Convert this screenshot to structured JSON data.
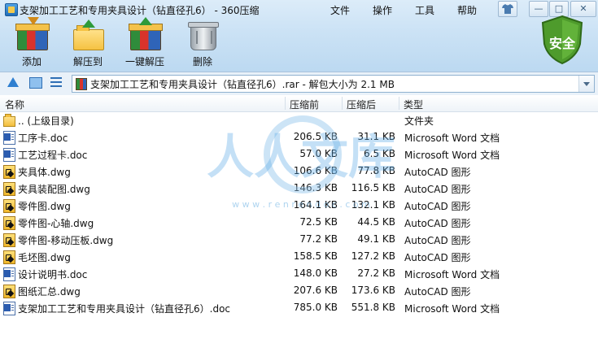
{
  "window": {
    "title": "支架加工工艺和专用夹具设计（钻直径孔6） - 360压缩"
  },
  "menu": {
    "file": "文件",
    "operate": "操作",
    "tools": "工具",
    "help": "帮助"
  },
  "window_controls": {
    "minimize": "—",
    "maximize": "□",
    "close": "✕"
  },
  "toolbar": {
    "add": "添加",
    "extract_to": "解压到",
    "one_click_extract": "一键解压",
    "delete": "删除"
  },
  "security": {
    "label": "安全"
  },
  "address": {
    "text": "支架加工工艺和专用夹具设计（钻直径孔6）.rar - 解包大小为 2.1 MB"
  },
  "columns": {
    "name": "名称",
    "compressed": "压缩前",
    "original": "压缩后",
    "type": "类型"
  },
  "files": [
    {
      "icon": "folder",
      "name": ".. (上级目录)",
      "compressed": "",
      "original": "",
      "type": "文件夹"
    },
    {
      "icon": "doc",
      "name": "工序卡.doc",
      "compressed": "206.5 KB",
      "original": "31.1 KB",
      "type": "Microsoft Word 文档"
    },
    {
      "icon": "doc",
      "name": "工艺过程卡.doc",
      "compressed": "57.0 KB",
      "original": "6.5 KB",
      "type": "Microsoft Word 文档"
    },
    {
      "icon": "dwg",
      "name": "夹具体.dwg",
      "compressed": "106.6 KB",
      "original": "77.8 KB",
      "type": "AutoCAD 图形"
    },
    {
      "icon": "dwg",
      "name": "夹具装配图.dwg",
      "compressed": "146.3 KB",
      "original": "116.5 KB",
      "type": "AutoCAD 图形"
    },
    {
      "icon": "dwg",
      "name": "零件图.dwg",
      "compressed": "164.1 KB",
      "original": "132.1 KB",
      "type": "AutoCAD 图形"
    },
    {
      "icon": "dwg",
      "name": "零件图-心轴.dwg",
      "compressed": "72.5 KB",
      "original": "44.5 KB",
      "type": "AutoCAD 图形"
    },
    {
      "icon": "dwg",
      "name": "零件图-移动压板.dwg",
      "compressed": "77.2 KB",
      "original": "49.1 KB",
      "type": "AutoCAD 图形"
    },
    {
      "icon": "dwg",
      "name": "毛坯图.dwg",
      "compressed": "158.5 KB",
      "original": "127.2 KB",
      "type": "AutoCAD 图形"
    },
    {
      "icon": "doc",
      "name": "设计说明书.doc",
      "compressed": "148.0 KB",
      "original": "27.2 KB",
      "type": "Microsoft Word 文档"
    },
    {
      "icon": "dwg",
      "name": "图纸汇总.dwg",
      "compressed": "207.6 KB",
      "original": "173.6 KB",
      "type": "AutoCAD 图形"
    },
    {
      "icon": "doc",
      "name": "支架加工工艺和专用夹具设计（钻直径孔6）.doc",
      "compressed": "785.0 KB",
      "original": "551.8 KB",
      "type": "Microsoft Word 文档"
    }
  ],
  "watermark": {
    "text": "人人文库",
    "url": "w w w . r e n r e n d o c . c o m"
  },
  "colors": {
    "accent": "#2f7fd0",
    "shield": "#4a9a2a",
    "toolbar_top": "#dcecf9"
  }
}
